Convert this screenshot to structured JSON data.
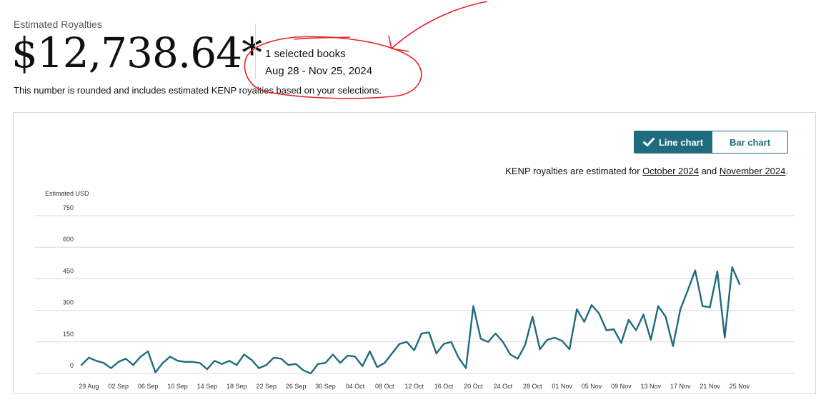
{
  "header": {
    "label": "Estimated Royalties",
    "amount": "$12,738.64*",
    "selected_books": "1 selected books",
    "date_range": "Aug 28 - Nov 25, 2024",
    "note": "This number is rounded and includes estimated KENP royalties based on your selections."
  },
  "toggle": {
    "line_label": "Line chart",
    "bar_label": "Bar chart"
  },
  "kenp": {
    "prefix": "KENP royalties are estimated for ",
    "link1": "October 2024",
    "middle": " and ",
    "link2": "November 2024",
    "suffix": "."
  },
  "colors": {
    "line": "#1e6c7d",
    "annotation": "#e8242a",
    "accent": "#1e6c7d"
  },
  "chart_data": {
    "type": "line",
    "ylabel": "Estimated USD",
    "xlabel": "",
    "title": "",
    "ylim": [
      0,
      750
    ],
    "yticks": [
      0,
      150,
      300,
      450,
      600,
      750
    ],
    "grid": true,
    "x_start": "2024-08-28",
    "x_tick_labels": [
      "29 Aug",
      "02 Sep",
      "06 Sep",
      "10 Sep",
      "14 Sep",
      "18 Sep",
      "22 Sep",
      "26 Sep",
      "30 Sep",
      "04 Oct",
      "08 Oct",
      "12 Oct",
      "16 Oct",
      "20 Oct",
      "24 Oct",
      "28 Oct",
      "01 Nov",
      "05 Nov",
      "09 Nov",
      "13 Nov",
      "17 Nov",
      "21 Nov",
      "25 Nov"
    ],
    "x_tick_every": 4,
    "x_tick_offset": 1,
    "series": [
      {
        "values": [
          40,
          75,
          60,
          50,
          25,
          55,
          70,
          40,
          80,
          105,
          5,
          50,
          80,
          60,
          55,
          55,
          50,
          20,
          60,
          45,
          60,
          40,
          90,
          65,
          25,
          40,
          75,
          70,
          40,
          45,
          15,
          0,
          45,
          50,
          90,
          50,
          85,
          80,
          35,
          105,
          30,
          50,
          95,
          140,
          150,
          110,
          190,
          195,
          95,
          140,
          150,
          75,
          25,
          320,
          165,
          150,
          190,
          150,
          90,
          70,
          135,
          270,
          115,
          160,
          170,
          155,
          115,
          305,
          245,
          325,
          285,
          205,
          210,
          145,
          255,
          205,
          280,
          160,
          320,
          270,
          130,
          305,
          395,
          490,
          320,
          315,
          485,
          170,
          505,
          425
        ]
      }
    ]
  }
}
